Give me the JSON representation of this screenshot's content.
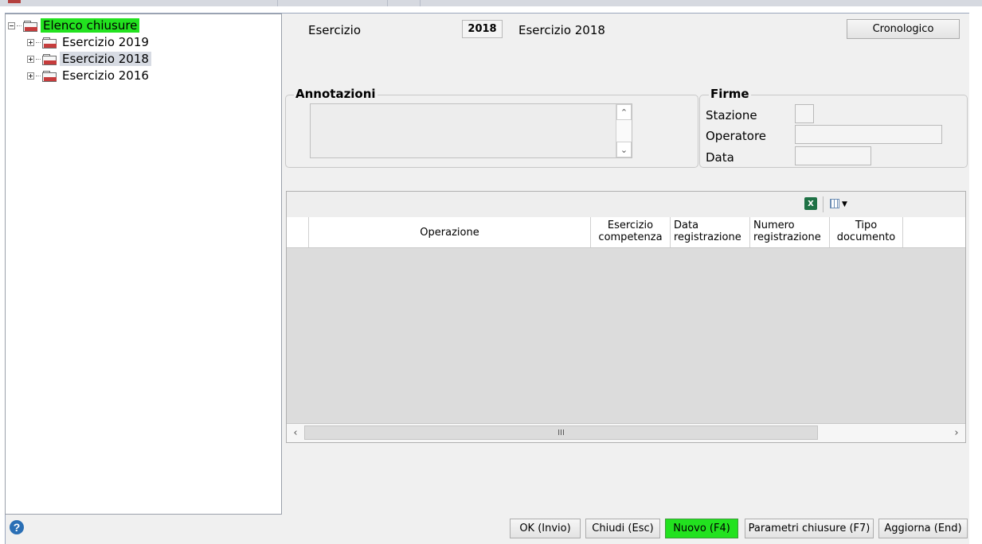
{
  "tree": {
    "root_label": "Elenco chiusure",
    "items": [
      {
        "label": "Esercizio 2019"
      },
      {
        "label": "Esercizio 2018"
      },
      {
        "label": "Esercizio 2016"
      }
    ]
  },
  "header": {
    "esercizio_label": "Esercizio",
    "esercizio_value": "2018",
    "esercizio_description": "Esercizio 2018",
    "cronologico_button": "Cronologico"
  },
  "annotazioni": {
    "title": "Annotazioni",
    "value": ""
  },
  "firme": {
    "title": "Firme",
    "stazione_label": "Stazione",
    "stazione_value": "",
    "operatore_label": "Operatore",
    "operatore_value": "",
    "data_label": "Data",
    "data_value": ""
  },
  "grid": {
    "toolbar": {
      "excel_icon": "excel-icon",
      "columns_icon": "column-chooser-icon"
    },
    "columns": [
      {
        "line1": "",
        "line2": "Operazione"
      },
      {
        "line1": "Esercizio",
        "line2": "competenza"
      },
      {
        "line1": "Data",
        "line2": "registrazione"
      },
      {
        "line1": "Numero",
        "line2": "registrazione"
      },
      {
        "line1": "Tipo",
        "line2": "documento"
      }
    ],
    "rows": [],
    "scroll_thumb_glyph": "III"
  },
  "footer": {
    "ok_button": "OK (Invio)",
    "chiudi_button": "Chiudi (Esc)",
    "nuovo_button": "Nuovo (F4)",
    "parametri_button": "Parametri chiusure (F7)",
    "aggiorna_button": "Aggiorna (End)",
    "help_icon": "help-icon"
  },
  "colors": {
    "highlight": "#22e21f",
    "selected": "#d7dbe3",
    "window_bg": "#f0f0f0"
  }
}
